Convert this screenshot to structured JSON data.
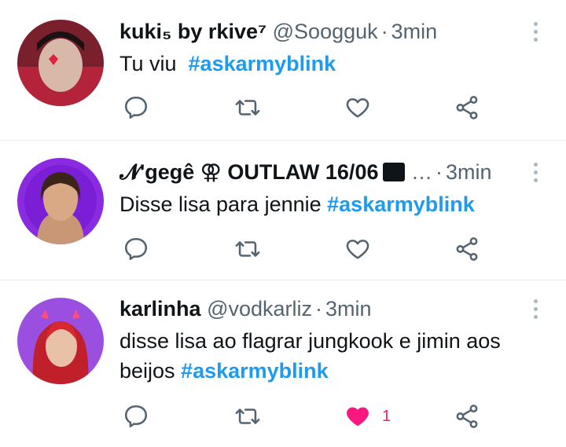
{
  "tweets": [
    {
      "name": "kuki₅ by rkive⁷",
      "handle": "@Soogguk",
      "time": "3min",
      "text_plain": "Tu viu  ",
      "hashtag": "#askarmyblink",
      "likes": ""
    },
    {
      "name": "𝓝'gegê ⚢ OUTLAW 16/06",
      "handle": "…",
      "time": "3min",
      "text_plain": "Disse lisa para jennie ",
      "hashtag": "#askarmyblink",
      "likes": ""
    },
    {
      "name": "karlinha",
      "handle": "@vodkarliz",
      "time": "3min",
      "text_plain": "disse lisa ao flagrar jungkook e jimin aos beijos ",
      "hashtag": "#askarmyblink",
      "likes": "1"
    }
  ],
  "colors": {
    "hashtag": "#1d9bf0",
    "icon": "#536471",
    "liked": "#f91880"
  }
}
